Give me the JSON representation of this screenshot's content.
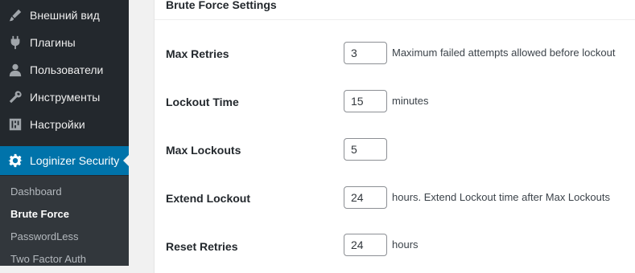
{
  "sidebar": {
    "items": [
      {
        "label": "Внешний вид",
        "icon": "paintbrush-icon"
      },
      {
        "label": "Плагины",
        "icon": "plugin-icon"
      },
      {
        "label": "Пользователи",
        "icon": "user-icon"
      },
      {
        "label": "Инструменты",
        "icon": "wrench-icon"
      },
      {
        "label": "Настройки",
        "icon": "settings-sliders-icon"
      }
    ],
    "active": {
      "label": "Loginizer Security",
      "icon": "gear-icon"
    },
    "submenu": [
      "Dashboard",
      "Brute Force",
      "PasswordLess",
      "Two Factor Auth"
    ]
  },
  "panel": {
    "title": "Brute Force Settings",
    "rows": [
      {
        "label": "Max Retries",
        "value": "3",
        "hint": "Maximum failed attempts allowed before lockout"
      },
      {
        "label": "Lockout Time",
        "value": "15",
        "hint": "minutes"
      },
      {
        "label": "Max Lockouts",
        "value": "5",
        "hint": ""
      },
      {
        "label": "Extend Lockout",
        "value": "24",
        "hint": "hours. Extend Lockout time after Max Lockouts"
      },
      {
        "label": "Reset Retries",
        "value": "24",
        "hint": "hours"
      }
    ]
  },
  "colors": {
    "sidebar_bg": "#23282d",
    "active_bg": "#0073aa",
    "submenu_bg": "#32373c"
  }
}
